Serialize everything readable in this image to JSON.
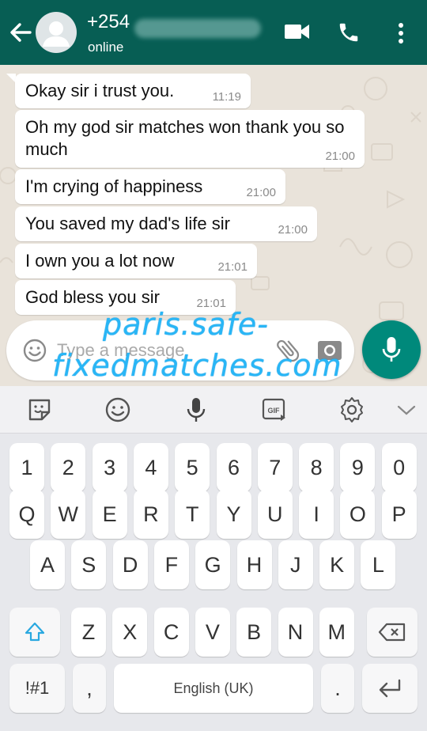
{
  "header": {
    "contact_name": "+254",
    "status": "online",
    "colors": {
      "bar": "#075e54"
    }
  },
  "messages": [
    {
      "text": "Okay sir i trust you.",
      "time": "11:19"
    },
    {
      "text": "Oh my god sir matches won thank you so much",
      "time": "21:00"
    },
    {
      "text": "I'm crying of happiness",
      "time": "21:00"
    },
    {
      "text": "You saved my dad's life sir",
      "time": "21:00"
    },
    {
      "text": "I own you a lot now",
      "time": "21:01"
    },
    {
      "text": "God bless you sir",
      "time": "21:01"
    }
  ],
  "composer": {
    "placeholder": "Type a message",
    "watermark_line1": "paris.safe-",
    "watermark_line2": "fixedmatches.com"
  },
  "keyboard": {
    "toolbar": [
      "sticker-icon",
      "emoji-icon",
      "voice-input-icon",
      "gif-icon",
      "settings-icon",
      "collapse-icon"
    ],
    "gif_label": "GIF",
    "row_numbers": [
      "1",
      "2",
      "3",
      "4",
      "5",
      "6",
      "7",
      "8",
      "9",
      "0"
    ],
    "row_top": [
      "Q",
      "W",
      "E",
      "R",
      "T",
      "Y",
      "U",
      "I",
      "O",
      "P"
    ],
    "row_middle": [
      "A",
      "S",
      "D",
      "F",
      "G",
      "H",
      "J",
      "K",
      "L"
    ],
    "row_bottom": [
      "Z",
      "X",
      "C",
      "V",
      "B",
      "N",
      "M"
    ],
    "symbols_label": "!#1",
    "comma_label": ",",
    "space_label": "English (UK)",
    "period_label": "."
  }
}
